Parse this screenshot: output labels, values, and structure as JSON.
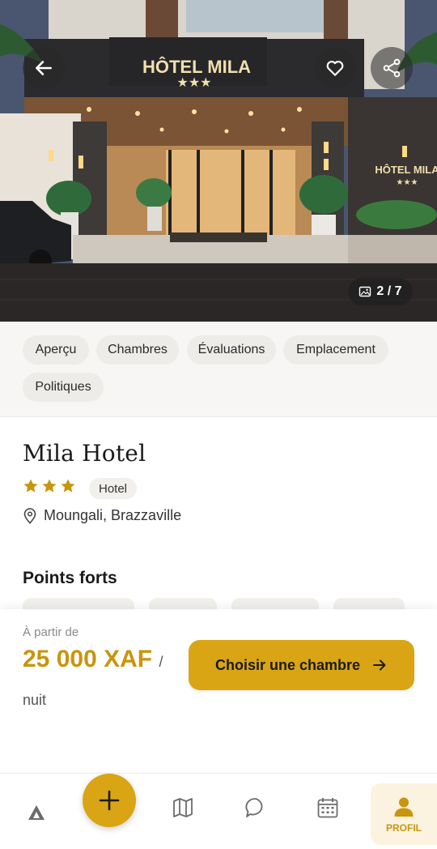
{
  "hero": {
    "sign_text": "HÔTEL MILA",
    "sign_stars": "★★★",
    "side_sign_text": "HÔTEL MILA",
    "side_sign_stars": "★★★",
    "photo_counter": "2 / 7",
    "icons": {
      "back": "arrow-left-icon",
      "favorite": "heart-icon",
      "share": "share-icon",
      "gallery": "image-icon"
    }
  },
  "tabs": [
    {
      "label": "Aperçu"
    },
    {
      "label": "Chambres"
    },
    {
      "label": "Évaluations"
    },
    {
      "label": "Emplacement"
    },
    {
      "label": "Politiques"
    }
  ],
  "hotel": {
    "name": "Mila Hotel",
    "star_count": 3,
    "type": "Hotel",
    "location": "Moungali, Brazzaville"
  },
  "highlights": {
    "title": "Points forts"
  },
  "pricing": {
    "from_label": "À partir de",
    "amount": "25 000 XAF",
    "unit": "/ nuit",
    "cta_label": "Choisir une chambre"
  },
  "bottom_nav": {
    "items": [
      {
        "icon": "home-logo-icon"
      },
      {
        "icon": "plus-icon"
      },
      {
        "icon": "map-icon"
      },
      {
        "icon": "chat-icon"
      },
      {
        "icon": "calendar-icon"
      },
      {
        "icon": "profile-icon",
        "label": "PROFIL",
        "active": true
      }
    ]
  },
  "colors": {
    "accent": "#d9a514",
    "accent_text": "#c8950f",
    "star": "#c8950f",
    "tab_bg": "#eeece8"
  }
}
